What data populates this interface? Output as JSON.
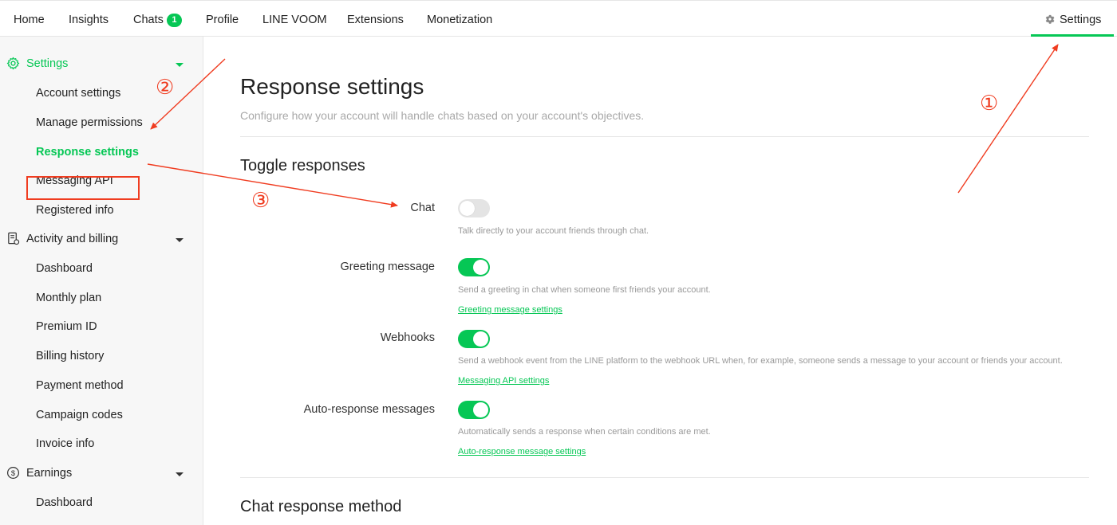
{
  "topnav": {
    "items": [
      {
        "label": "Home"
      },
      {
        "label": "Insights"
      },
      {
        "label": "Chats",
        "badge": "1"
      },
      {
        "label": "Profile"
      },
      {
        "label": "LINE VOOM"
      },
      {
        "label": "Extensions"
      },
      {
        "label": "Monetization"
      }
    ],
    "settings_label": "Settings",
    "settings_icon": "gear-icon"
  },
  "sidebar": {
    "groups": [
      {
        "label": "Settings",
        "icon": "gear-icon",
        "items": [
          "Account settings",
          "Manage permissions",
          "Response settings",
          "Messaging API",
          "Registered info"
        ]
      },
      {
        "label": "Activity and billing",
        "icon": "receipt-icon",
        "items": [
          "Dashboard",
          "Monthly plan",
          "Premium ID",
          "Billing history",
          "Payment method",
          "Campaign codes",
          "Invoice info"
        ]
      },
      {
        "label": "Earnings",
        "icon": "dollar-circle-icon",
        "items": [
          "Dashboard"
        ]
      }
    ],
    "active_item": "Response settings"
  },
  "main": {
    "title": "Response settings",
    "description": "Configure how your account will handle chats based on your account's objectives.",
    "toggle_section_title": "Toggle responses",
    "toggles": [
      {
        "label": "Chat",
        "enabled": false,
        "description": "Talk directly to your account friends through chat.",
        "link": ""
      },
      {
        "label": "Greeting message",
        "enabled": true,
        "description": "Send a greeting in chat when someone first friends your account.",
        "link": "Greeting message settings"
      },
      {
        "label": "Webhooks",
        "enabled": true,
        "description": "Send a webhook event from the LINE platform to the webhook URL when, for example, someone sends a message to your account or friends your account.",
        "link": "Messaging API settings"
      },
      {
        "label": "Auto-response messages",
        "enabled": true,
        "description": "Automatically sends a response when certain conditions are met.",
        "link": "Auto-response message settings"
      }
    ],
    "chat_method_title": "Chat response method"
  },
  "annotations": {
    "step1": "①",
    "step2": "②",
    "step3": "③"
  },
  "colors": {
    "accent": "#06c755",
    "annotation": "#f03c20"
  }
}
